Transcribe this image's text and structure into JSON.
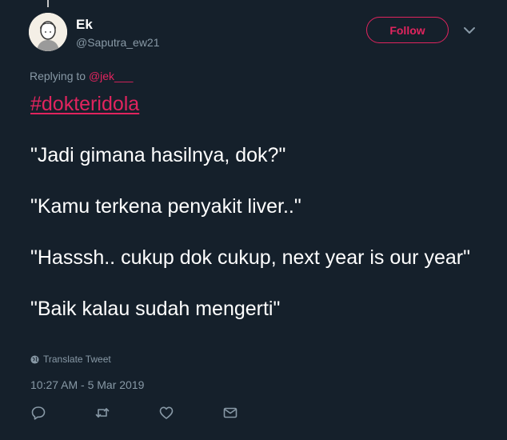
{
  "user": {
    "display_name": "Ek",
    "handle": "@Saputra_ew21"
  },
  "follow_button": {
    "label": "Follow"
  },
  "reply_context": {
    "prefix": "Replying to",
    "mention": "@jek___"
  },
  "tweet": {
    "hashtag": "#dokteridola",
    "lines": [
      "\"Jadi gimana hasilnya, dok?\"",
      "\"Kamu terkena penyakit liver..\"",
      "\"Hasssh.. cukup dok cukup, next year is our year\"",
      "\"Baik kalau sudah mengerti\""
    ],
    "translate_label": "Translate Tweet",
    "timestamp": "10:27 AM - 5 Mar 2019"
  },
  "icons": {
    "translate": "globe-icon",
    "reply": "reply-icon",
    "retweet": "retweet-icon",
    "like": "heart-icon",
    "dm": "envelope-icon",
    "caret": "chevron-down-icon"
  },
  "colors": {
    "background": "#15202b",
    "accent": "#e0245e",
    "muted": "#8899a6",
    "text": "#ffffff"
  }
}
